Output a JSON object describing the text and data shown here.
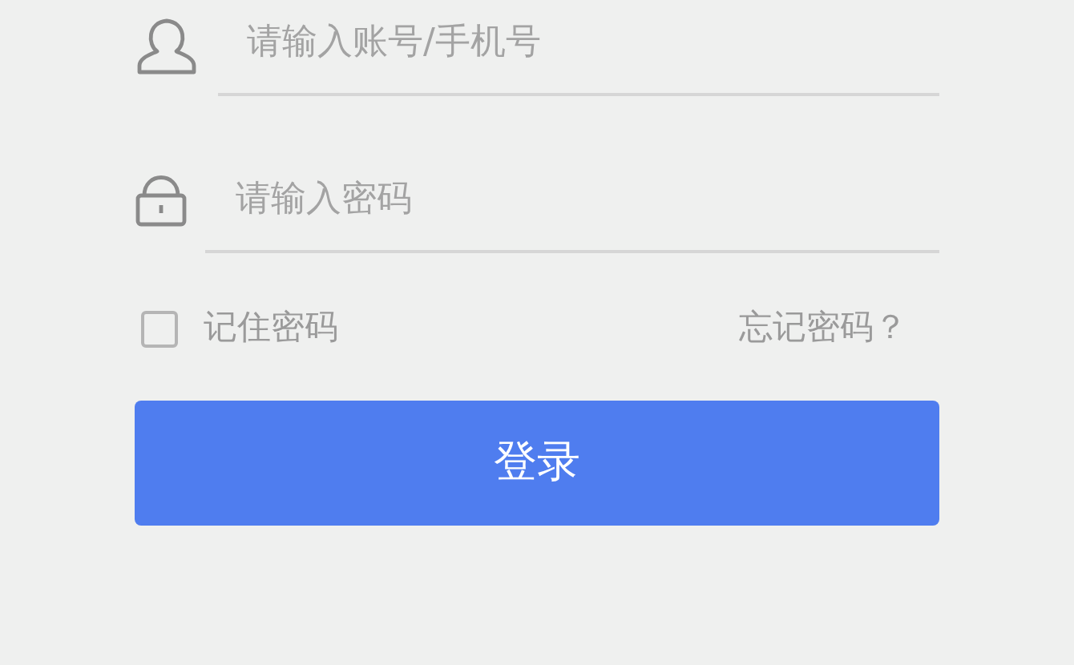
{
  "account_field": {
    "placeholder": "请输入账号/手机号"
  },
  "password_field": {
    "placeholder": "请输入密码"
  },
  "remember": {
    "label": "记住密码",
    "checked": false
  },
  "forgot_link": "忘记密码？",
  "login_button": "登录"
}
